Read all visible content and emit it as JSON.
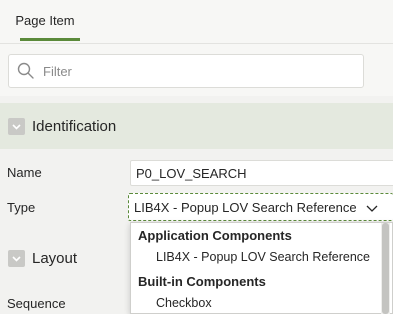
{
  "tabs": [
    {
      "label": "Page Item",
      "active": true
    }
  ],
  "filter": {
    "placeholder": "Filter",
    "value": ""
  },
  "sections": {
    "identification": {
      "title": "Identification",
      "collapsed": false
    },
    "layout": {
      "title": "Layout",
      "collapsed": false
    }
  },
  "fields": {
    "name": {
      "label": "Name",
      "value": "P0_LOV_SEARCH"
    },
    "type": {
      "label": "Type",
      "value": "LIB4X - Popup LOV Search Reference"
    },
    "sequence": {
      "label": "Sequence"
    }
  },
  "dropdown": {
    "groups": [
      {
        "label": "Application Components",
        "items": [
          "LIB4X - Popup LOV Search Reference"
        ]
      },
      {
        "label": "Built-in Components",
        "items": [
          "Checkbox"
        ]
      }
    ]
  },
  "colors": {
    "accent": "#5b8a3a",
    "section_active_bg": "#e4e9df",
    "page_bg": "#f2f2f0"
  },
  "icons": {
    "search": "search-icon",
    "collapse": "collapse-icon",
    "chevron": "chevron-down-icon"
  }
}
